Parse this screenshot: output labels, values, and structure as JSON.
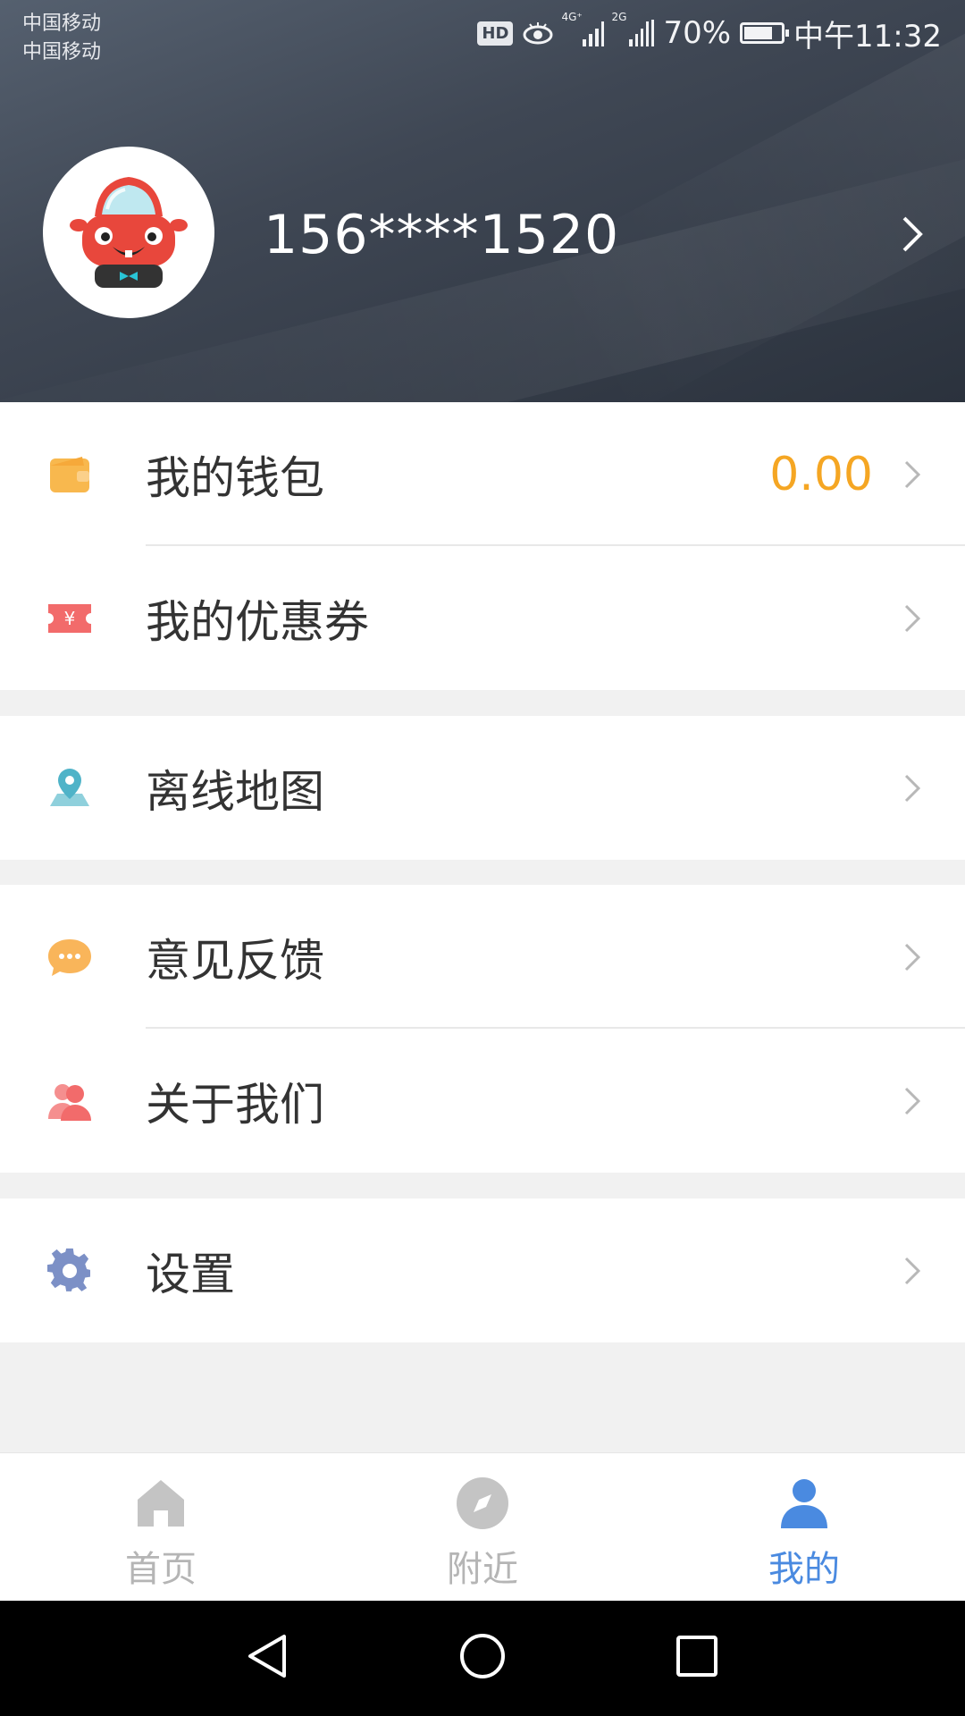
{
  "status_bar": {
    "carrier_1": "中国移动",
    "carrier_2": "中国移动",
    "hd": "HD",
    "net_1": "4G⁺",
    "net_2": "2G",
    "battery_percent": "70%",
    "battery_level": 0.7,
    "time": "中午11:32"
  },
  "profile": {
    "phone": "156****1520"
  },
  "menu": {
    "wallet": {
      "label": "我的钱包",
      "value": "0.00",
      "icon": "wallet-icon",
      "color": "#f8b84e"
    },
    "coupons": {
      "label": "我的优惠券",
      "icon": "coupon-icon",
      "color": "#f26b6b"
    },
    "offline_map": {
      "label": "离线地图",
      "icon": "map-pin-icon",
      "color": "#4fb3c8"
    },
    "feedback": {
      "label": "意见反馈",
      "icon": "chat-bubble-icon",
      "color": "#f9b55a"
    },
    "about": {
      "label": "关于我们",
      "icon": "people-icon",
      "color": "#f27b7b"
    },
    "settings": {
      "label": "设置",
      "icon": "gear-icon",
      "color": "#7c90c6"
    }
  },
  "tabbar": {
    "home": {
      "label": "首页",
      "color": "#b5b5b5"
    },
    "nearby": {
      "label": "附近",
      "color": "#b5b5b5"
    },
    "mine": {
      "label": "我的",
      "color": "#4a8ae0",
      "active": true
    }
  },
  "colors": {
    "accent": "#4a8ae0",
    "wallet_value": "#f5a623"
  }
}
